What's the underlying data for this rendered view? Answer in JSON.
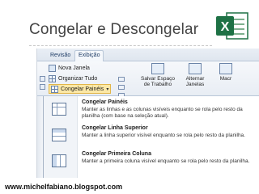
{
  "slide": {
    "title": "Congelar e Descongelar",
    "footer": "www.michelfabiano.blogspot.com",
    "logo_letter": "X"
  },
  "ribbon": {
    "tabs": [
      "Revisão",
      "Exibição"
    ],
    "active_tab": "Exibição",
    "commands": {
      "nova_janela": "Nova Janela",
      "organizar_tudo": "Organizar Tudo",
      "congelar_paineis": "Congelar Painéis",
      "salvar_espaco": "Salvar Espaço de Trabalho",
      "salvar_line1": "Salvar Espaço",
      "salvar_line2": "de Trabalho",
      "alternar_line1": "Alternar",
      "alternar_line2": "Janelas",
      "macros": "Macr"
    }
  },
  "menu": {
    "items": [
      {
        "icon": "freeze-panes-icon",
        "title": "Congelar Painéis",
        "desc": "Manter as linhas e as colunas visíveis enquanto se rola pelo resto da planilha (com base na seleção atual)."
      },
      {
        "icon": "freeze-top-row-icon",
        "title": "Congelar Linha Superior",
        "desc": "Manter a linha superior visível enquanto se rola pelo resto da planilha."
      },
      {
        "icon": "freeze-first-column-icon",
        "title": "Congelar Primeira Coluna",
        "desc": "Manter a primeira coluna visível enquanto se rola pelo resto da planilha."
      }
    ]
  },
  "colors": {
    "excel_green": "#1e7145",
    "ribbon_blue": "#1f3d66",
    "title_gray": "#444444"
  }
}
